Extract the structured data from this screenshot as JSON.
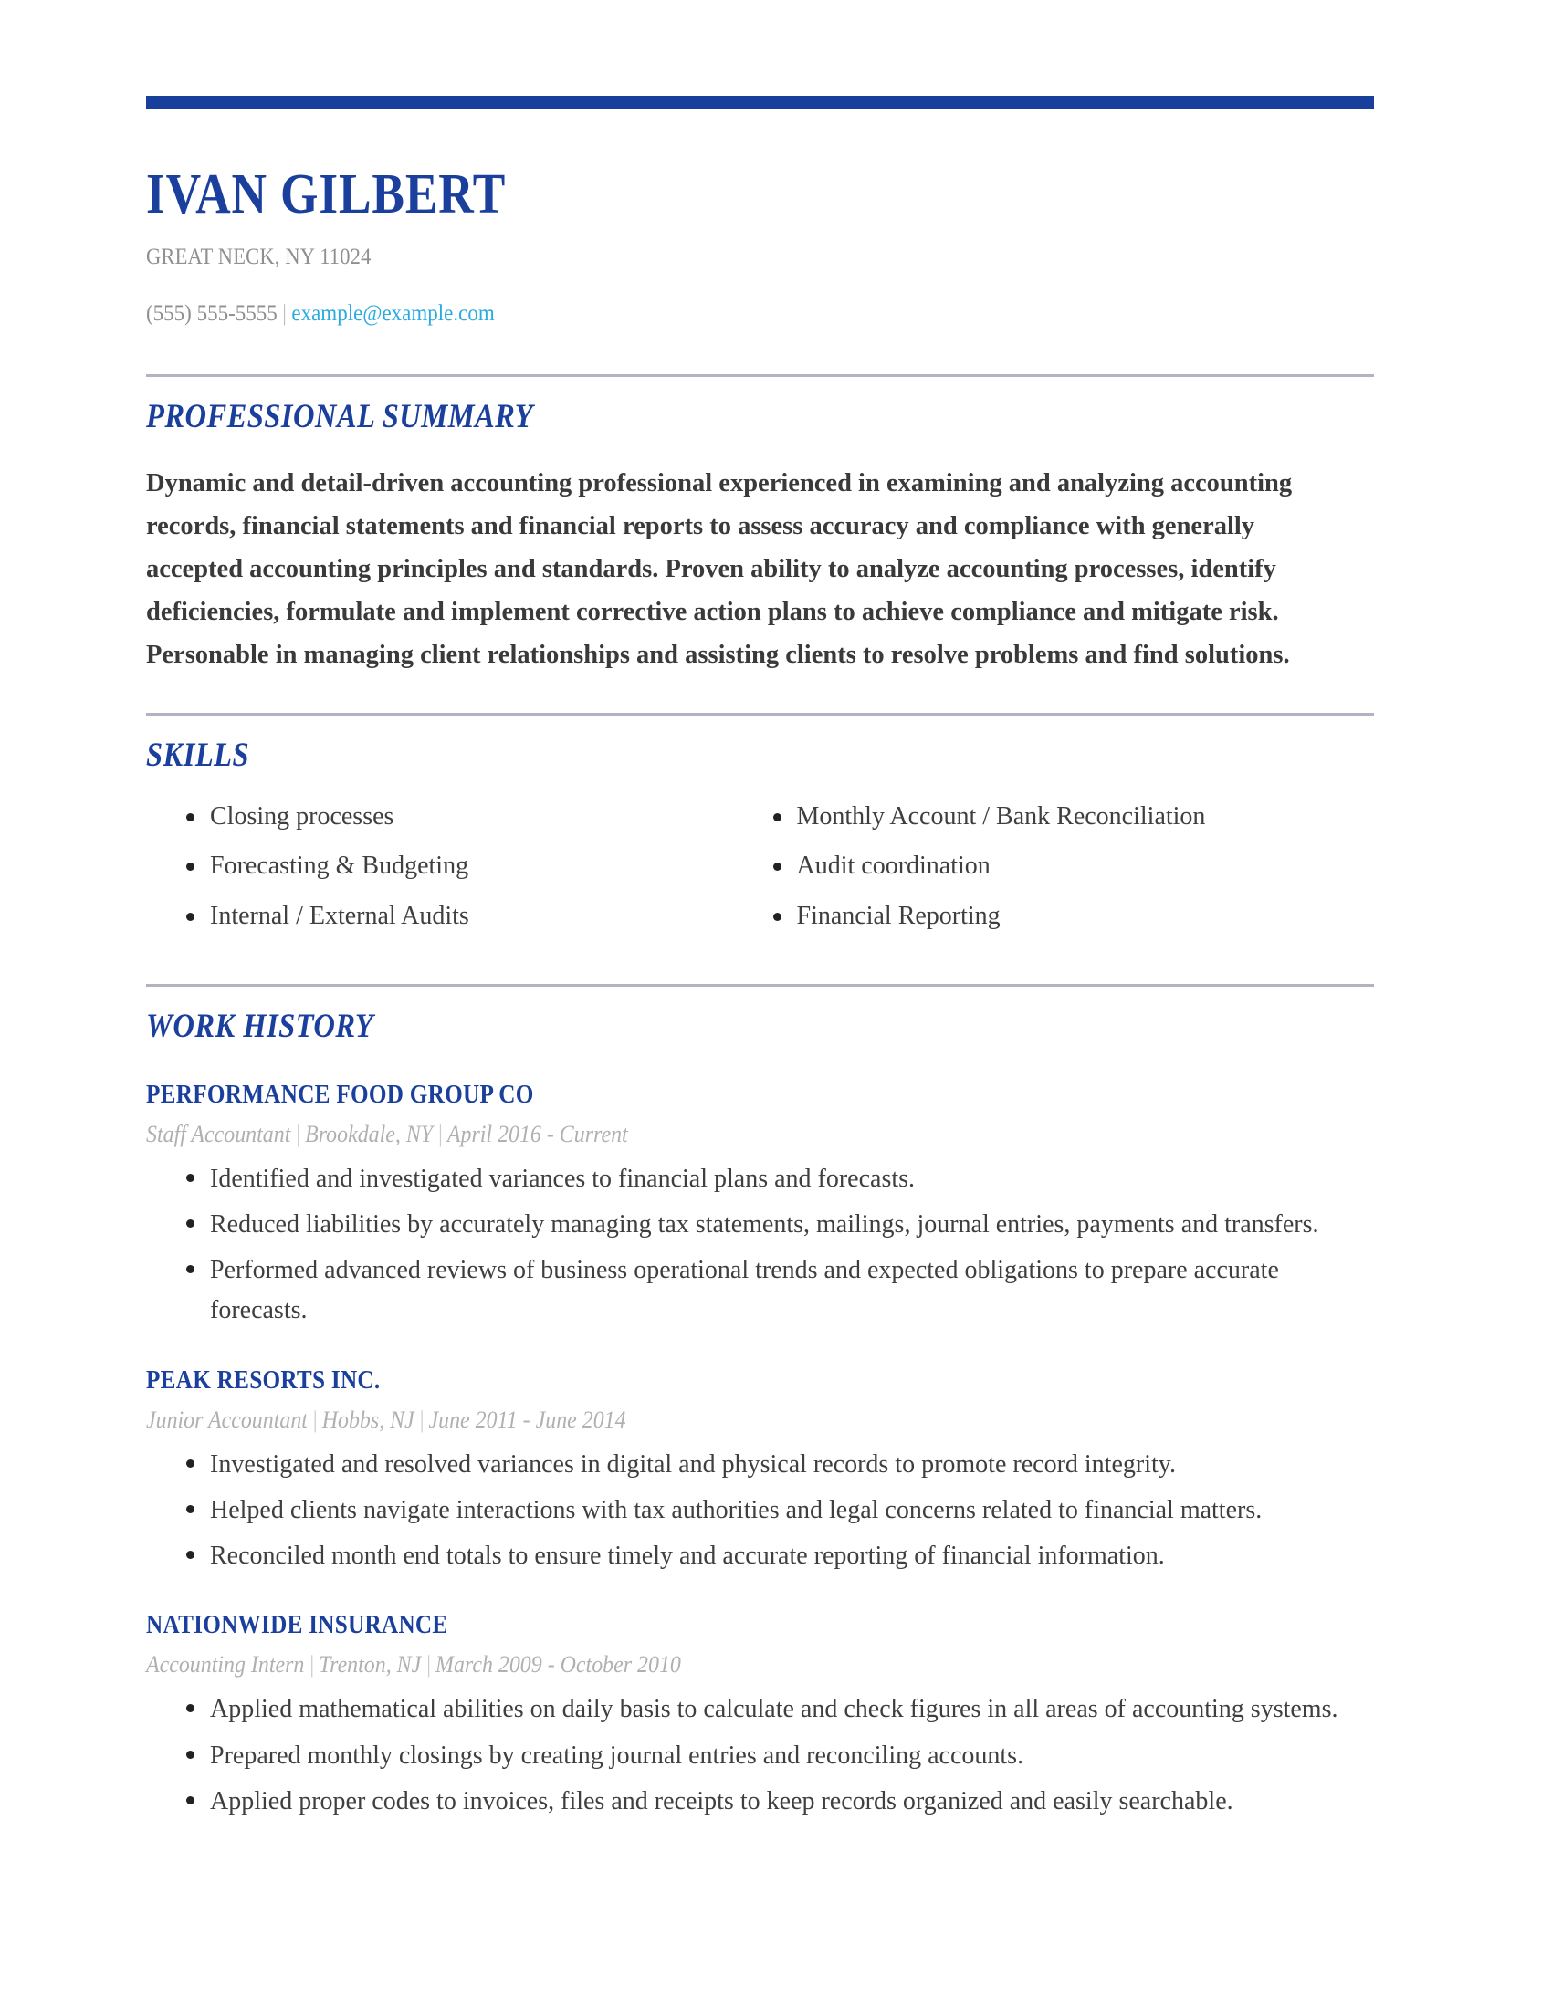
{
  "theme": {
    "accent_blue": "#183f9b",
    "heading_blue": "#1a3f9c",
    "link_cyan": "#29abe2",
    "muted_gray": "#8f8f8f",
    "meta_gray": "#b0b0b0",
    "divider_gray": "#b2b2c0",
    "body_text": "#3f3f3f"
  },
  "header": {
    "name": "IVAN GILBERT",
    "address": "GREAT NECK, NY 11024",
    "phone": "(555) 555-5555",
    "separator": "|",
    "email": "example@example.com"
  },
  "sections": {
    "summary": {
      "title": "PROFESSIONAL SUMMARY",
      "text": "Dynamic and detail-driven accounting professional experienced in examining and analyzing accounting records, financial statements and financial reports to assess accuracy and compliance with generally accepted accounting principles and standards. Proven ability to analyze accounting processes, identify deficiencies, formulate and implement corrective action plans to achieve compliance and mitigate risk. Personable in managing client relationships and assisting clients to resolve problems and find solutions."
    },
    "skills": {
      "title": "SKILLS",
      "left_column": [
        "Closing processes",
        "Forecasting & Budgeting",
        "Internal / External Audits"
      ],
      "right_column": [
        "Monthly Account / Bank Reconciliation",
        "Audit coordination",
        "Financial Reporting"
      ]
    },
    "work_history": {
      "title": "WORK HISTORY",
      "jobs": [
        {
          "company": "PERFORMANCE FOOD GROUP CO",
          "role": "Staff Accountant",
          "location": "Brookdale, NY",
          "dates": "April 2016 - Current",
          "bullets": [
            "Identified and investigated variances to financial plans and forecasts.",
            "Reduced liabilities by accurately managing tax statements, mailings, journal entries, payments and transfers.",
            "Performed advanced reviews of business operational trends and expected obligations to prepare accurate forecasts."
          ]
        },
        {
          "company": "PEAK RESORTS INC.",
          "role": "Junior Accountant",
          "location": "Hobbs, NJ",
          "dates": "June 2011 - June 2014",
          "bullets": [
            "Investigated and resolved variances in digital and physical records to promote record integrity.",
            "Helped clients navigate interactions with tax authorities and legal concerns related to financial matters.",
            "Reconciled month end totals to ensure timely and accurate reporting of financial information."
          ]
        },
        {
          "company": "NATIONWIDE INSURANCE",
          "role": "Accounting Intern",
          "location": "Trenton, NJ",
          "dates": "March 2009 - October 2010",
          "bullets": [
            "Applied mathematical abilities on daily basis to calculate and check figures in all areas of accounting systems.",
            "Prepared monthly closings by creating journal entries and reconciling accounts.",
            "Applied proper codes to invoices, files and receipts to keep records organized and easily searchable."
          ]
        }
      ]
    }
  }
}
